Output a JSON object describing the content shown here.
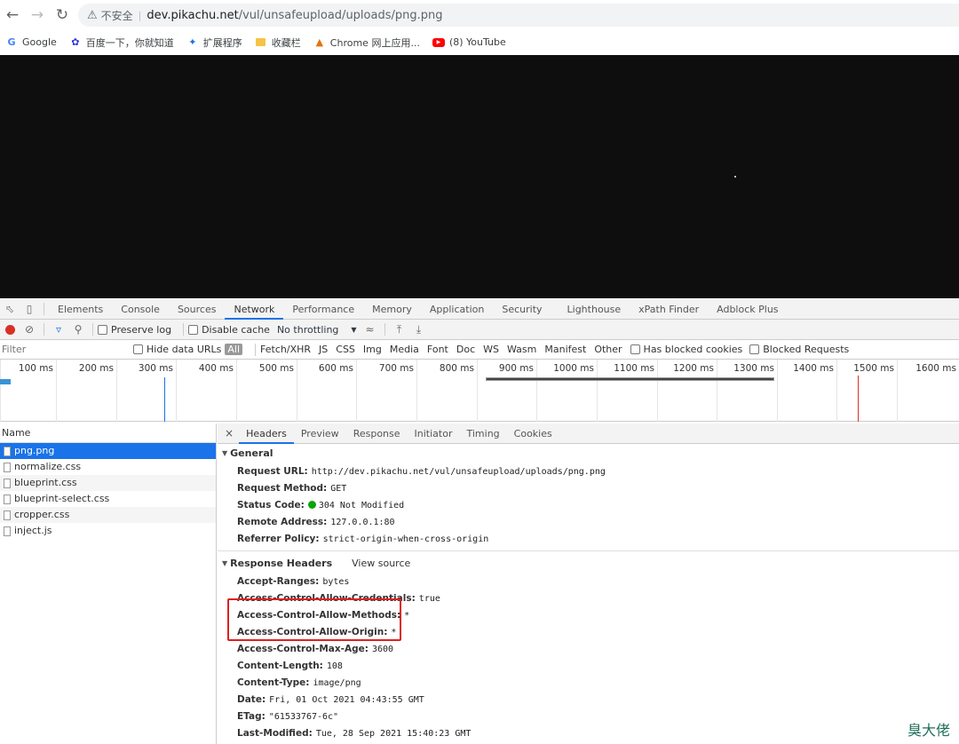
{
  "browser": {
    "security_label": "不安全",
    "url_host": "dev.pikachu.net",
    "url_path": "/vul/unsafeupload/uploads/png.png"
  },
  "bookmarks": [
    {
      "label": "Google",
      "icon": "google-icon"
    },
    {
      "label": "百度一下，你就知道",
      "icon": "baidu-icon"
    },
    {
      "label": "扩展程序",
      "icon": "puzzle-icon"
    },
    {
      "label": "收藏栏",
      "icon": "folder-icon"
    },
    {
      "label": "Chrome 网上应用...",
      "icon": "chrome-store-icon"
    },
    {
      "label": "(8) YouTube",
      "icon": "youtube-icon"
    }
  ],
  "devtools": {
    "tabs": [
      "Elements",
      "Console",
      "Sources",
      "Network",
      "Performance",
      "Memory",
      "Application",
      "Security",
      "Lighthouse",
      "xPath Finder",
      "Adblock Plus"
    ],
    "active_tab": "Network",
    "toolbar": {
      "preserve_log": "Preserve log",
      "disable_cache": "Disable cache",
      "throttling": "No throttling"
    },
    "filter": {
      "placeholder": "Filter",
      "hide_data_urls": "Hide data URLs",
      "types": [
        "All",
        "Fetch/XHR",
        "JS",
        "CSS",
        "Img",
        "Media",
        "Font",
        "Doc",
        "WS",
        "Wasm",
        "Manifest",
        "Other"
      ],
      "has_blocked_cookies": "Has blocked cookies",
      "blocked_requests": "Blocked Requests"
    },
    "timeline_ticks": [
      "100 ms",
      "200 ms",
      "300 ms",
      "400 ms",
      "500 ms",
      "600 ms",
      "700 ms",
      "800 ms",
      "900 ms",
      "1000 ms",
      "1100 ms",
      "1200 ms",
      "1300 ms",
      "1400 ms",
      "1500 ms",
      "1600 ms"
    ],
    "request_list": {
      "header": "Name",
      "items": [
        "png.png",
        "normalize.css",
        "blueprint.css",
        "blueprint-select.css",
        "cropper.css",
        "inject.js"
      ]
    },
    "detail_tabs": [
      "Headers",
      "Preview",
      "Response",
      "Initiator",
      "Timing",
      "Cookies"
    ],
    "general": {
      "title": "General",
      "rows": [
        {
          "k": "Request URL:",
          "v": "http://dev.pikachu.net/vul/unsafeupload/uploads/png.png"
        },
        {
          "k": "Request Method:",
          "v": "GET"
        },
        {
          "k": "Status Code:",
          "v": "304 Not Modified"
        },
        {
          "k": "Remote Address:",
          "v": "127.0.0.1:80"
        },
        {
          "k": "Referrer Policy:",
          "v": "strict-origin-when-cross-origin"
        }
      ]
    },
    "response_headers": {
      "title": "Response Headers",
      "view_source": "View source",
      "rows": [
        {
          "k": "Accept-Ranges:",
          "v": "bytes"
        },
        {
          "k": "Access-Control-Allow-Credentials:",
          "v": "true"
        },
        {
          "k": "Access-Control-Allow-Methods:",
          "v": "*"
        },
        {
          "k": "Access-Control-Allow-Origin:",
          "v": "*"
        },
        {
          "k": "Access-Control-Max-Age:",
          "v": "3600"
        },
        {
          "k": "Content-Length:",
          "v": "108"
        },
        {
          "k": "Content-Type:",
          "v": "image/png"
        },
        {
          "k": "Date:",
          "v": "Fri, 01 Oct 2021 04:43:55 GMT"
        },
        {
          "k": "ETag:",
          "v": "\"61533767-6c\""
        },
        {
          "k": "Last-Modified:",
          "v": "Tue, 28 Sep 2021 15:40:23 GMT"
        }
      ]
    }
  },
  "watermark": "臭大佬",
  "colors": {
    "accent": "#1a73e8",
    "highlight_box": "#e02020",
    "status_ok": "#0ca40c"
  }
}
